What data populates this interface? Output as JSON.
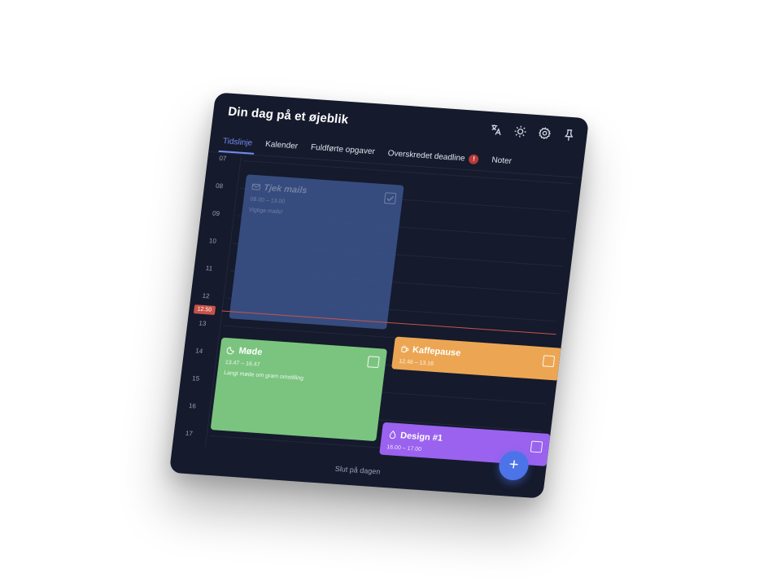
{
  "header": {
    "title": "Din dag på et øjeblik"
  },
  "header_icons": [
    "translate-icon",
    "sun-icon",
    "gear-icon",
    "pin-icon"
  ],
  "tabs": [
    {
      "label": "Tidslinje",
      "active": true
    },
    {
      "label": "Kalender"
    },
    {
      "label": "Fuldførte opgaver"
    },
    {
      "label": "Overskredet deadline",
      "badge": "!"
    },
    {
      "label": "Noter"
    }
  ],
  "timeline": {
    "hours": [
      "07",
      "08",
      "09",
      "10",
      "11",
      "12",
      "13",
      "14",
      "15",
      "16",
      "17"
    ],
    "now_label": "12.50"
  },
  "events": {
    "mails": {
      "title": "Tjek mails",
      "time": "08.00 – 13.00",
      "desc": "Vigtige mails!",
      "icon": "envelope-icon",
      "checked": true
    },
    "mode": {
      "title": "Møde",
      "time": "13.47 – 16.47",
      "desc": "Langt møde om gram omstilling",
      "icon": "moon-icon",
      "checked": false
    },
    "kaffe": {
      "title": "Kaffepause",
      "time": "12.46 – 13.16",
      "icon": "coffee-icon",
      "checked": false
    },
    "design": {
      "title": "Design #1",
      "time": "16.00 – 17.00",
      "icon": "drop-icon",
      "checked": false
    }
  },
  "footer": {
    "text": "Slut på dagen"
  },
  "fab": {
    "label": "+"
  },
  "colors": {
    "background": "#151a2c",
    "accent": "#6f8cf0",
    "now": "#c9534a",
    "mails": "#3a5288",
    "mode": "#7bc47f",
    "kaffe": "#eca653",
    "design": "#9a62ef",
    "fab": "#4c74e8"
  }
}
